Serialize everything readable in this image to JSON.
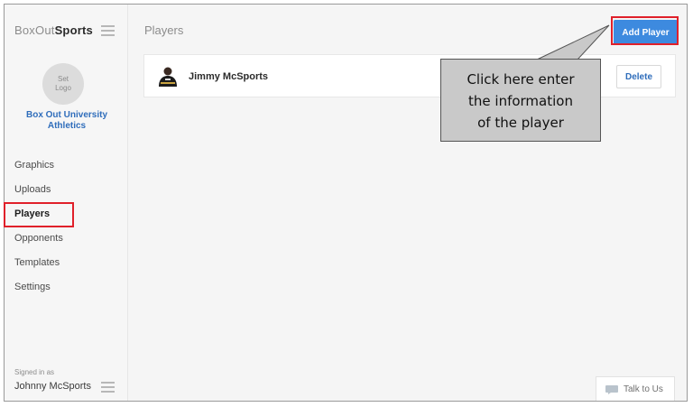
{
  "sidebar": {
    "brand_light": "BoxOut",
    "brand_bold": "Sports",
    "logo_placeholder": "Set\nLogo",
    "organization": "Box Out University Athletics",
    "nav": [
      {
        "label": "Graphics"
      },
      {
        "label": "Uploads"
      },
      {
        "label": "Players"
      },
      {
        "label": "Opponents"
      },
      {
        "label": "Templates"
      },
      {
        "label": "Settings"
      }
    ],
    "signed_in_label": "Signed in as",
    "user_name": "Johnny McSports"
  },
  "header": {
    "title": "Players",
    "add_button": "Add Player"
  },
  "players": [
    {
      "name": "Jimmy McSports",
      "delete_label": "Delete"
    }
  ],
  "support": {
    "talk_label": "Talk to Us"
  },
  "annotation": {
    "callout_text": "Click here enter\nthe information\nof the player",
    "highlight_color": "#e0202a"
  },
  "colors": {
    "accent": "#3d8adf",
    "link": "#2f6dbb"
  }
}
